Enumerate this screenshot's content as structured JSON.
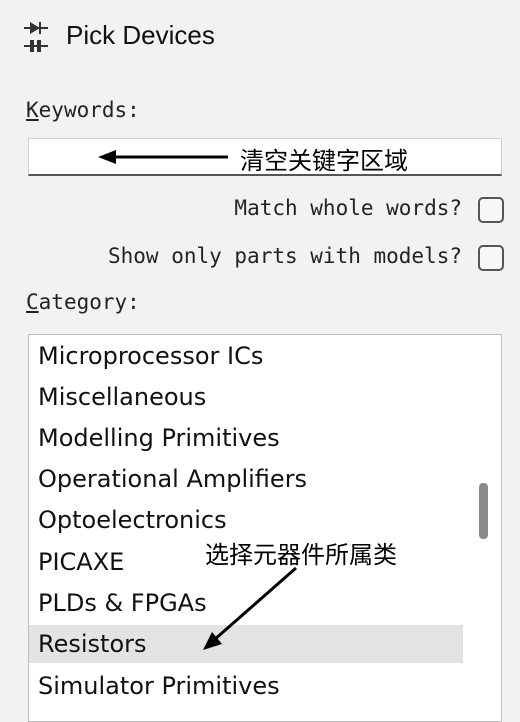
{
  "window": {
    "title": "Pick Devices",
    "icon": "diode-icon"
  },
  "keywords": {
    "label_first": "K",
    "label_rest": "eywords:",
    "value": "",
    "annotation": "清空关键字区域"
  },
  "options": {
    "match_whole_words": {
      "label": "Match whole words?",
      "checked": false
    },
    "show_only_models": {
      "label": "Show only parts with models?",
      "checked": false
    }
  },
  "category": {
    "label_first": "C",
    "label_rest": "ategory:",
    "items": [
      "Microprocessor ICs",
      "Miscellaneous",
      "Modelling Primitives",
      "Operational Amplifiers",
      "Optoelectronics",
      "PICAXE",
      "PLDs & FPGAs",
      "Resistors",
      "Simulator Primitives"
    ],
    "selected": "Resistors",
    "annotation": "选择元器件所属类"
  }
}
